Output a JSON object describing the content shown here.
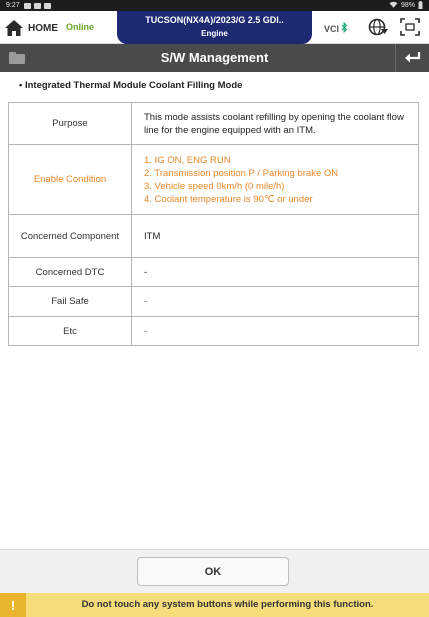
{
  "status_bar": {
    "time": "9:27",
    "battery": "98%"
  },
  "header": {
    "home_label": "HOME",
    "connection_status": "Online",
    "vehicle": "TUCSON(NX4A)/2023/G 2.5 GDI..",
    "system": "Engine",
    "vci_label": "VCI"
  },
  "titlebar": {
    "title": "S/W Management"
  },
  "content": {
    "mode_title": "• Integrated Thermal Module Coolant Filling Mode",
    "rows": [
      {
        "label": "Purpose",
        "value": "This mode assists coolant refilling by opening the coolant flow line for the engine equipped with an ITM."
      },
      {
        "label": "Enable Condition",
        "lines": [
          "1. IG ON, ENG RUN",
          "2. Transmission position P / Parking brake ON",
          "3. Vehicle speed 0km/h (0 mile/h)",
          "4. Coolant temperature is 90℃ or under"
        ]
      },
      {
        "label": "Concerned Component",
        "value": "ITM"
      },
      {
        "label": "Concerned DTC",
        "value": "-"
      },
      {
        "label": "Fail Safe",
        "value": "-"
      },
      {
        "label": "Etc",
        "value": "-"
      }
    ]
  },
  "footer": {
    "ok_label": "OK",
    "warning_icon": "!",
    "warning_text": "Do not touch any system buttons while performing this function."
  },
  "colors": {
    "vehicle_box": "#1d2a72",
    "online": "#6aa52c",
    "enable_condition": "#e8872a",
    "titlebar": "#494a4c",
    "warning_bar": "#f6dc7a"
  }
}
